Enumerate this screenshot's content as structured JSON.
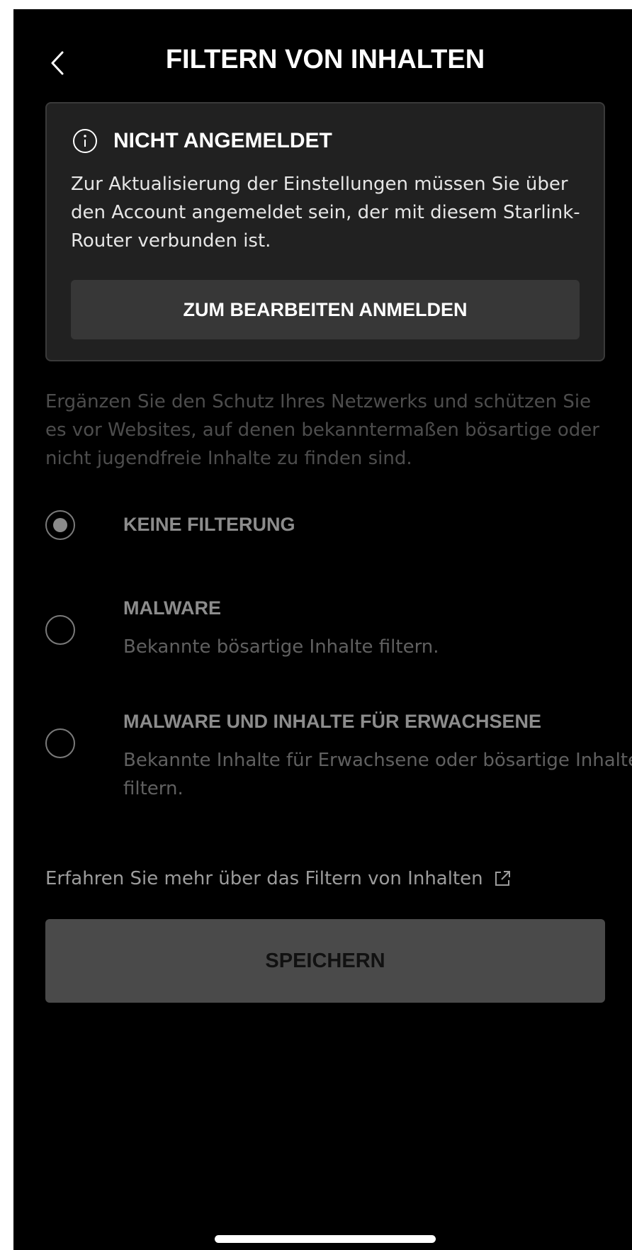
{
  "header": {
    "title": "FILTERN VON INHALTEN",
    "back_icon": "chevron-left-icon"
  },
  "notice": {
    "icon": "info-icon",
    "title": "NICHT ANGEMELDET",
    "body": "Zur Aktualisierung der Einstellungen müssen Sie über den Account angemeldet sein, der mit diesem Starlink-Router verbunden ist.",
    "button_label": "ZUM BEARBEITEN ANMELDEN"
  },
  "intro": "Ergänzen Sie den Schutz Ihres Netzwerks und schützen Sie es vor Websites, auf denen bekanntermaßen bösartige oder nicht jugendfreie Inhalte zu finden sind.",
  "options": [
    {
      "label": "KEINE FILTERUNG",
      "description": "",
      "selected": true
    },
    {
      "label": "MALWARE",
      "description": "Bekannte bösartige Inhalte filtern.",
      "selected": false
    },
    {
      "label": "MALWARE UND INHALTE FÜR ERWACHSENE",
      "description": "Bekannte Inhalte für Erwachsene oder bösartige Inhalte filtern.",
      "selected": false
    }
  ],
  "learn_more": {
    "label": "Erfahren Sie mehr über das Filtern von Inhalten",
    "icon": "external-link-icon"
  },
  "save_label": "SPEICHERN",
  "colors": {
    "background": "#000000",
    "card": "#212121",
    "card_button": "#373737",
    "save_button": "#4a4a4a",
    "muted_text": "#4d4d4d"
  }
}
